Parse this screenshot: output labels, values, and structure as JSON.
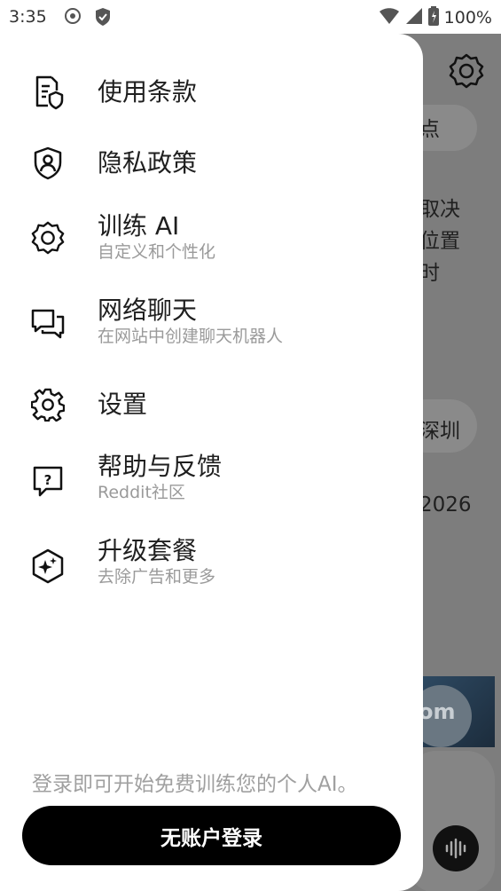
{
  "status_bar": {
    "time": "3:35",
    "battery": "100%"
  },
  "menu": [
    {
      "title": "使用条款",
      "subtitle": "",
      "icon": "document-shield-icon"
    },
    {
      "title": "隐私政策",
      "subtitle": "",
      "icon": "user-shield-icon"
    },
    {
      "title": "训练 AI",
      "subtitle": "自定义和个性化",
      "icon": "ai-gear-icon"
    },
    {
      "title": "网络聊天",
      "subtitle": "在网站中创建聊天机器人",
      "icon": "chat-bubbles-icon"
    },
    {
      "title": "设置",
      "subtitle": "",
      "icon": "gear-icon"
    },
    {
      "title": "帮助与反馈",
      "subtitle": "Reddit社区",
      "icon": "help-bubble-icon"
    },
    {
      "title": "升级套餐",
      "subtitle": "去除广告和更多",
      "icon": "sparkle-hexagon-icon"
    }
  ],
  "promo_text": "登录即可开始免费训练您的个人AI。",
  "login_button": "无账户登录",
  "background": {
    "chip1": "点",
    "line1": "取决",
    "line2": "位置",
    "line3": "时",
    "chip2": "深圳",
    "year": "2026",
    "img_text": "om"
  }
}
